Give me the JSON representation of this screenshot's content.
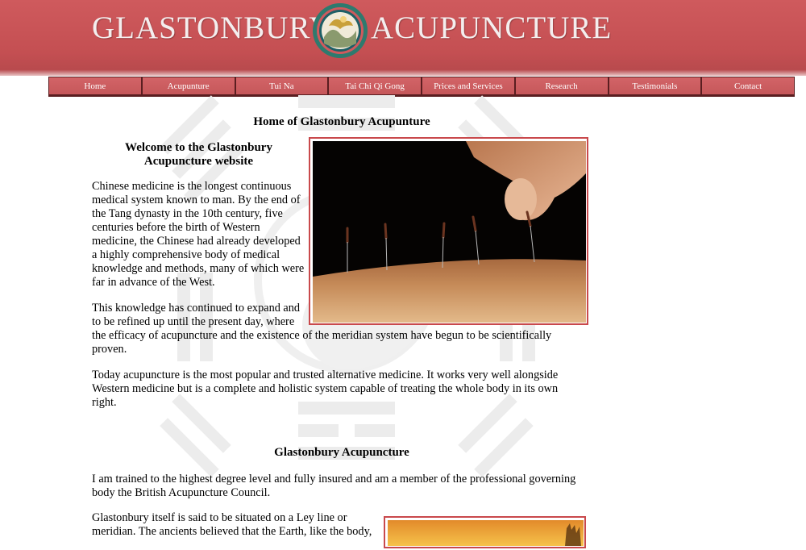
{
  "header": {
    "title_left": "GLASTONBURY",
    "title_right": "ACUPUNCTURE",
    "emblem_icon": "logo-emblem-icon"
  },
  "nav": {
    "items": [
      {
        "label": "Home"
      },
      {
        "label": "Acupunture"
      },
      {
        "label": "Tui Na"
      },
      {
        "label": "Tai Chi Qi Gong"
      },
      {
        "label": "Prices and Services"
      },
      {
        "label": "Research"
      },
      {
        "label": "Testimonials"
      },
      {
        "label": "Contact"
      }
    ]
  },
  "main": {
    "heading": "Home of Glastonbury Acupunture",
    "welcome_heading": "Welcome to the Glastonbury Acupuncture website",
    "para1": "Chinese medicine is the longest continuous medical system known to man. By the end of the Tang dynasty in the 10th century, five centuries before the birth of Western medicine, the Chinese had already developed a highly comprehensive body of medical knowledge and methods, many of which were far in advance of the West.",
    "para2a": "This knowledge has continued to expand and to be refined up until the present day, where",
    "para2b": "the efficacy of acupuncture and the existence of the meridian system have begun to be scientifically proven.",
    "para3": "Today acupuncture is the most popular and trusted alternative medicine. It works very well alongside Western medicine but is a complete and holistic system capable of treating the whole body in its own right.",
    "sub_heading": "Glastonbury Acupuncture",
    "para4": "I am trained to the highest degree level and fully insured and am a member of the professional governing body the British Acupuncture Council.",
    "para5": "Glastonbury itself is said to be situated on a Ley line or meridian. The ancients believed that the Earth, like the body,"
  },
  "colors": {
    "header_red": "#c44f52",
    "nav_red": "#c5575a",
    "frame_red": "#c9494c"
  }
}
